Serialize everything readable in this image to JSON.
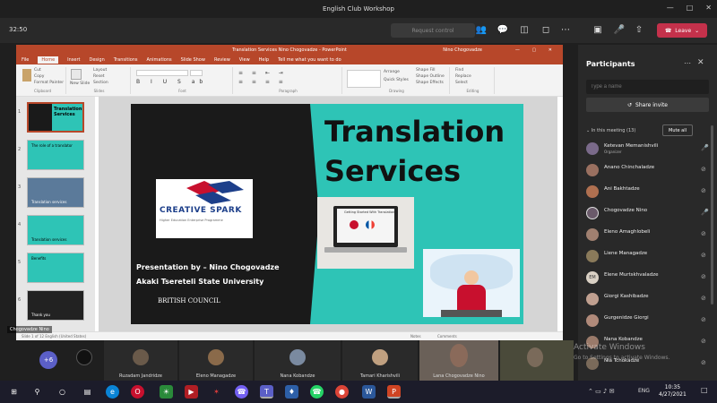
{
  "window": {
    "title": "English Club Workshop"
  },
  "meeting": {
    "timer": "32:50",
    "request_control": "Request control",
    "leave": "Leave"
  },
  "ppt": {
    "title": "Translation Services Nino Chogovadze - PowerPoint",
    "user": "Nino Chogovadze",
    "tabs": [
      "File",
      "Home",
      "Insert",
      "Design",
      "Transitions",
      "Animations",
      "Slide Show",
      "Review",
      "View",
      "Help",
      "Tell me what you want to do"
    ],
    "groups": [
      "Clipboard",
      "Slides",
      "Font",
      "Paragraph",
      "Drawing",
      "Editing"
    ],
    "clipboard": {
      "cut": "Cut",
      "copy": "Copy",
      "format": "Format Painter"
    },
    "slides_group": {
      "new": "New Slide",
      "layout": "Layout",
      "reset": "Reset",
      "section": "Section"
    },
    "drawing": {
      "fill": "Shape Fill",
      "outline": "Shape Outline",
      "effects": "Shape Effects",
      "arrange": "Arrange",
      "styles": "Quick Styles"
    },
    "editing": {
      "find": "Find",
      "replace": "Replace",
      "select": "Select"
    },
    "status": "Slide 1 of 12   English (United States)",
    "notes": "Notes",
    "comments": "Comments"
  },
  "slide": {
    "title_line1": "Translation",
    "title_line2": "Services",
    "presenter": "Presentation by – Nino Chogovadze",
    "university": "Akaki Tsereteli State University",
    "council": "BRITISH COUNCIL",
    "logo_text": "CREATIVE SPARK",
    "logo_sub": "Higher Education Enterprise Programme",
    "laptop_text": "Getting Started With Translation"
  },
  "thumbnails": [
    {
      "num": "1",
      "title": "Translation Services"
    },
    {
      "num": "2",
      "title": "The role of a translator"
    },
    {
      "num": "3",
      "title": "Translation services"
    },
    {
      "num": "4",
      "title": "Translation services"
    },
    {
      "num": "5",
      "title": "Benefits"
    },
    {
      "num": "6",
      "title": "Thank you"
    }
  ],
  "presenter_label": "Chogovadze Nino",
  "panel": {
    "title": "Participants",
    "search_placeholder": "Type a name",
    "share_invite": "Share invite",
    "in_meeting": "In this meeting (13)",
    "mute_all": "Mute all",
    "people": [
      {
        "name": "Ketevan Memanishvili",
        "role": "Organizer",
        "initials": ""
      },
      {
        "name": "Anano Chinchaladze",
        "role": "",
        "initials": ""
      },
      {
        "name": "Ani Bakhtadze",
        "role": "",
        "initials": ""
      },
      {
        "name": "Chogovadze Nino",
        "role": "",
        "initials": ""
      },
      {
        "name": "Eleno Amaghlobeli",
        "role": "",
        "initials": ""
      },
      {
        "name": "Liene Managadze",
        "role": "",
        "initials": ""
      },
      {
        "name": "Elene Murtskhvaladze",
        "role": "",
        "initials": "EM"
      },
      {
        "name": "Giorgi Kashibadze",
        "role": "",
        "initials": ""
      },
      {
        "name": "Gurgenidze Giorgi",
        "role": "",
        "initials": ""
      },
      {
        "name": "Nana Kobandze",
        "role": "",
        "initials": ""
      },
      {
        "name": "Nia Tchokadze",
        "role": "",
        "initials": ""
      }
    ]
  },
  "videos": [
    {
      "label": ""
    },
    {
      "label": ""
    },
    {
      "label": "Ruzadam Jandridze"
    },
    {
      "label": "Eleno Managadze"
    },
    {
      "label": "Nana Kobandze"
    },
    {
      "label": "Tamari Kharishvili"
    },
    {
      "label": "Lana Chogovadze Nino"
    },
    {
      "label": ""
    }
  ],
  "activate": {
    "line1": "Activate Windows",
    "line2": "Go to Settings to activate Windows."
  },
  "taskbar": {
    "time": "10:35",
    "date": "4/27/2021",
    "lang": "ENG"
  },
  "colors": {
    "teal": "#2ec4b6",
    "ppt_red": "#b7472a",
    "leave_red": "#c4314b"
  }
}
